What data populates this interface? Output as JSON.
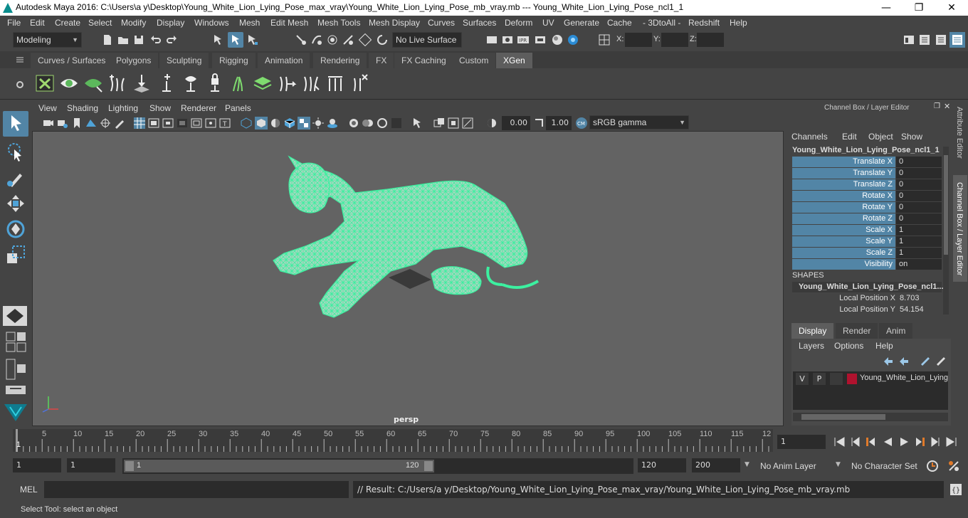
{
  "window": {
    "title": "Autodesk Maya 2016: C:\\Users\\a y\\Desktop\\Young_White_Lion_Lying_Pose_max_vray\\Young_White_Lion_Lying_Pose_mb_vray.mb   ---   Young_White_Lion_Lying_Pose_ncl1_1",
    "minimize": "—",
    "maximize": "❐",
    "close": "✕"
  },
  "menubar": [
    "File",
    "Edit",
    "Create",
    "Select",
    "Modify",
    "Display",
    "Windows",
    "Mesh",
    "Edit Mesh",
    "Mesh Tools",
    "Mesh Display",
    "Curves",
    "Surfaces",
    "Deform",
    "UV",
    "Generate",
    "Cache",
    "- 3DtoAll -",
    "Redshift",
    "Help"
  ],
  "statusline": {
    "mode": "Modeling",
    "live_surface": "No Live Surface",
    "x_label": "X:",
    "y_label": "Y:",
    "z_label": "Z:"
  },
  "shelf_tabs": [
    "Curves / Surfaces",
    "Polygons",
    "Sculpting",
    "Rigging",
    "Animation",
    "Rendering",
    "FX",
    "FX Caching",
    "Custom",
    "XGen"
  ],
  "active_shelf_tab": "XGen",
  "viewport": {
    "menu": [
      "View",
      "Shading",
      "Lighting",
      "Show",
      "Renderer",
      "Panels"
    ],
    "exposure": "0.00",
    "gamma": "1.00",
    "colorspace": "sRGB gamma",
    "camera_label": "persp"
  },
  "channelbox": {
    "header": "Channel Box / Layer Editor",
    "menu": [
      "Channels",
      "Edit",
      "Object",
      "Show"
    ],
    "object_name": "Young_White_Lion_Lying_Pose_ncl1_1",
    "attributes": [
      {
        "label": "Translate X",
        "value": "0"
      },
      {
        "label": "Translate Y",
        "value": "0"
      },
      {
        "label": "Translate Z",
        "value": "0"
      },
      {
        "label": "Rotate X",
        "value": "0"
      },
      {
        "label": "Rotate Y",
        "value": "0"
      },
      {
        "label": "Rotate Z",
        "value": "0"
      },
      {
        "label": "Scale X",
        "value": "1"
      },
      {
        "label": "Scale Y",
        "value": "1"
      },
      {
        "label": "Scale Z",
        "value": "1"
      },
      {
        "label": "Visibility",
        "value": "on"
      }
    ],
    "shapes_header": "SHAPES",
    "shape_name": "Young_White_Lion_Lying_Pose_ncl1...",
    "shape_attrs": [
      {
        "label": "Local Position X",
        "value": "8.703"
      },
      {
        "label": "Local Position Y",
        "value": "54.154"
      }
    ]
  },
  "layer_editor": {
    "tabs": [
      "Display",
      "Render",
      "Anim"
    ],
    "active_tab": "Display",
    "menu": [
      "Layers",
      "Options",
      "Help"
    ],
    "layer": {
      "v": "V",
      "p": "P",
      "name": "Young_White_Lion_Lying",
      "color": "#b0122e"
    }
  },
  "side_tabs": [
    "Attribute Editor",
    "Channel Box / Layer Editor"
  ],
  "timeline": {
    "ticks": [
      "1",
      "5",
      "10",
      "15",
      "20",
      "25",
      "30",
      "35",
      "40",
      "45",
      "50",
      "55",
      "60",
      "65",
      "70",
      "75",
      "80",
      "85",
      "90",
      "95",
      "100",
      "105",
      "110",
      "115",
      "12"
    ],
    "current_frame": "1"
  },
  "range": {
    "start": "1",
    "playback_start": "1",
    "slider_start": "1",
    "slider_end": "120",
    "playback_end": "120",
    "end": "200",
    "anim_layer": "No Anim Layer",
    "character_set": "No Character Set"
  },
  "cmdline": {
    "mel_label": "MEL",
    "result": "// Result: C:/Users/a y/Desktop/Young_White_Lion_Lying_Pose_max_vray/Young_White_Lion_Lying_Pose_mb_vray.mb"
  },
  "helpline": "Select Tool: select an object",
  "colors": {
    "accent": "#5285a6",
    "wire": "#44f29a",
    "viewport_bg": "#636363"
  }
}
